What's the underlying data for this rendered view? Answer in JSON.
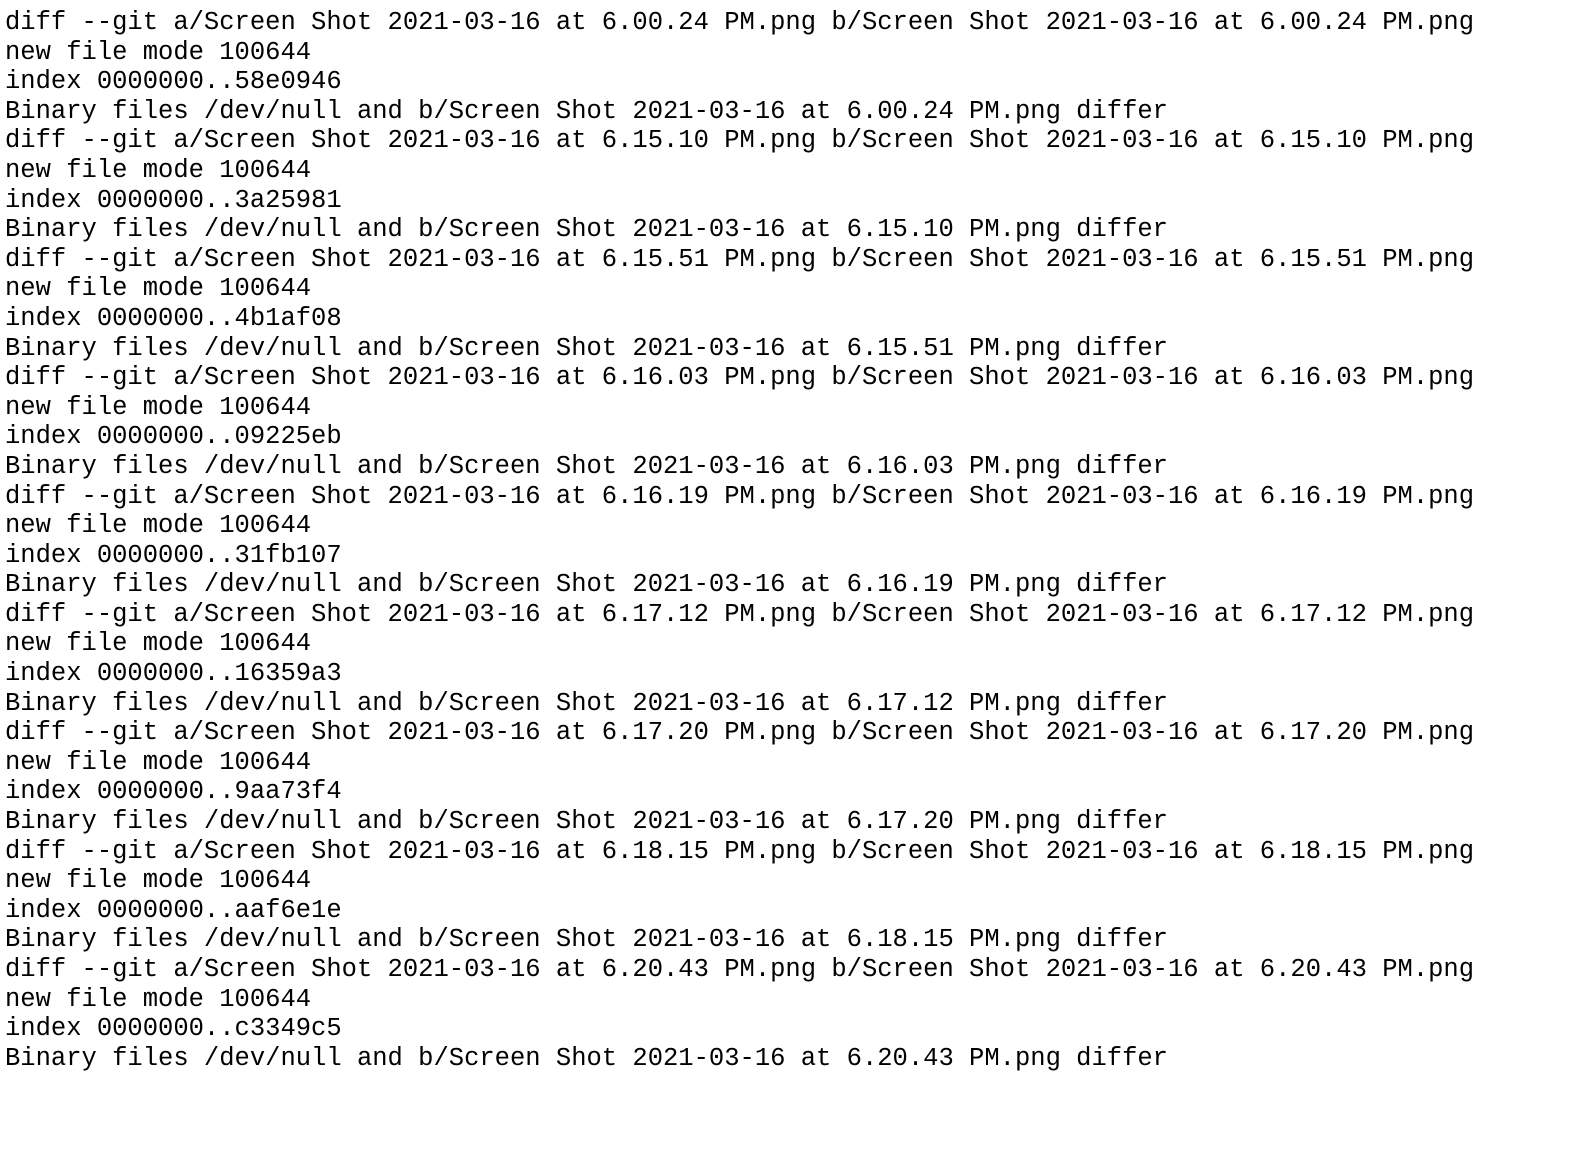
{
  "terminal": {
    "lines": [
      "diff --git a/Screen Shot 2021-03-16 at 6.00.24 PM.png b/Screen Shot 2021-03-16 at 6.00.24 PM.png",
      "new file mode 100644",
      "index 0000000..58e0946",
      "Binary files /dev/null and b/Screen Shot 2021-03-16 at 6.00.24 PM.png differ",
      "diff --git a/Screen Shot 2021-03-16 at 6.15.10 PM.png b/Screen Shot 2021-03-16 at 6.15.10 PM.png",
      "new file mode 100644",
      "index 0000000..3a25981",
      "Binary files /dev/null and b/Screen Shot 2021-03-16 at 6.15.10 PM.png differ",
      "diff --git a/Screen Shot 2021-03-16 at 6.15.51 PM.png b/Screen Shot 2021-03-16 at 6.15.51 PM.png",
      "new file mode 100644",
      "index 0000000..4b1af08",
      "Binary files /dev/null and b/Screen Shot 2021-03-16 at 6.15.51 PM.png differ",
      "diff --git a/Screen Shot 2021-03-16 at 6.16.03 PM.png b/Screen Shot 2021-03-16 at 6.16.03 PM.png",
      "new file mode 100644",
      "index 0000000..09225eb",
      "Binary files /dev/null and b/Screen Shot 2021-03-16 at 6.16.03 PM.png differ",
      "diff --git a/Screen Shot 2021-03-16 at 6.16.19 PM.png b/Screen Shot 2021-03-16 at 6.16.19 PM.png",
      "new file mode 100644",
      "index 0000000..31fb107",
      "Binary files /dev/null and b/Screen Shot 2021-03-16 at 6.16.19 PM.png differ",
      "diff --git a/Screen Shot 2021-03-16 at 6.17.12 PM.png b/Screen Shot 2021-03-16 at 6.17.12 PM.png",
      "new file mode 100644",
      "index 0000000..16359a3",
      "Binary files /dev/null and b/Screen Shot 2021-03-16 at 6.17.12 PM.png differ",
      "diff --git a/Screen Shot 2021-03-16 at 6.17.20 PM.png b/Screen Shot 2021-03-16 at 6.17.20 PM.png",
      "new file mode 100644",
      "index 0000000..9aa73f4",
      "Binary files /dev/null and b/Screen Shot 2021-03-16 at 6.17.20 PM.png differ",
      "diff --git a/Screen Shot 2021-03-16 at 6.18.15 PM.png b/Screen Shot 2021-03-16 at 6.18.15 PM.png",
      "new file mode 100644",
      "index 0000000..aaf6e1e",
      "Binary files /dev/null and b/Screen Shot 2021-03-16 at 6.18.15 PM.png differ",
      "diff --git a/Screen Shot 2021-03-16 at 6.20.43 PM.png b/Screen Shot 2021-03-16 at 6.20.43 PM.png",
      "new file mode 100644",
      "index 0000000..c3349c5",
      "Binary files /dev/null and b/Screen Shot 2021-03-16 at 6.20.43 PM.png differ"
    ]
  },
  "colors": {
    "background": "#ffffff",
    "text": "#000000"
  }
}
